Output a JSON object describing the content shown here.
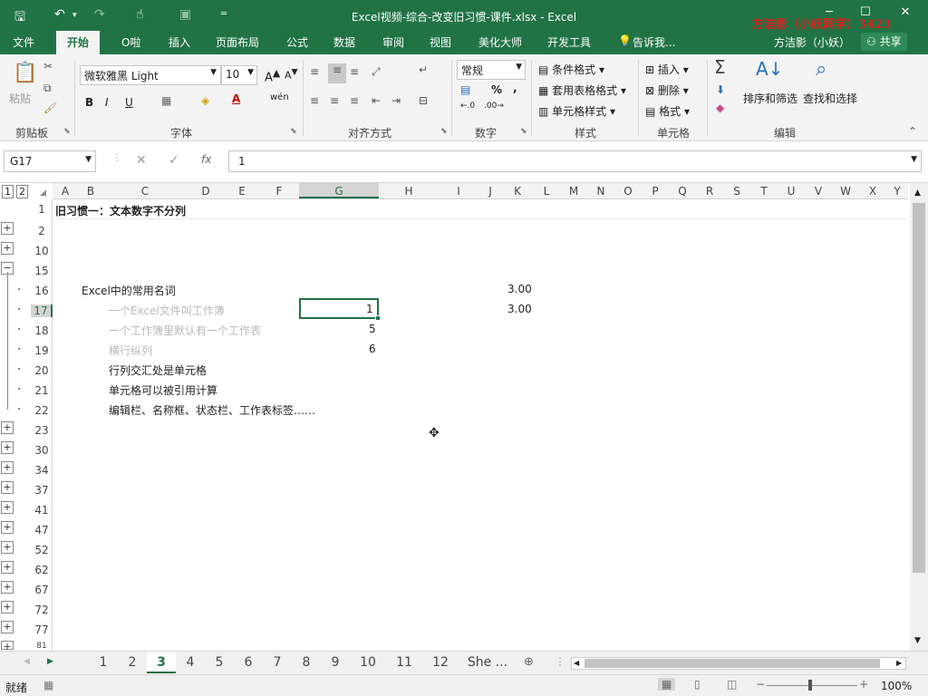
{
  "window": {
    "title": "Excel视频-综合-改变旧习惯-课件.xlsx - Excel",
    "watermark": "方洁影（小妖同学）3423",
    "user": "方洁影（小妖）",
    "share": "共享"
  },
  "tabs": [
    "文件",
    "开始",
    "O啦",
    "插入",
    "页面布局",
    "公式",
    "数据",
    "审阅",
    "视图",
    "美化大师",
    "开发工具",
    "告诉我..."
  ],
  "ribbon": {
    "clipboard": {
      "paste": "粘贴",
      "label": "剪贴板"
    },
    "font": {
      "name": "微软雅黑 Light",
      "size": "10",
      "bold": "B",
      "italic": "I",
      "underline": "U",
      "label": "字体"
    },
    "alignment": {
      "label": "对齐方式"
    },
    "number": {
      "format": "常规",
      "label": "数字"
    },
    "styles": {
      "conditional": "条件格式",
      "table": "套用表格格式",
      "cell": "单元格样式",
      "label": "样式"
    },
    "cells": {
      "insert": "插入",
      "delete": "删除",
      "format": "格式",
      "label": "单元格"
    },
    "editing": {
      "sort": "排序和筛选",
      "find": "查找和选择",
      "label": "编辑"
    }
  },
  "formula_bar": {
    "name_box": "G17",
    "fx": "fx",
    "value": "1"
  },
  "columns": [
    "A",
    "B",
    "C",
    "D",
    "E",
    "F",
    "G",
    "H",
    "I",
    "J",
    "K",
    "L",
    "M",
    "N",
    "O",
    "P",
    "Q",
    "R",
    "S",
    "T",
    "U",
    "V",
    "W",
    "X",
    "Y"
  ],
  "outline_levels": [
    "1",
    "2"
  ],
  "rows": [
    "1",
    "2",
    "10",
    "15",
    "16",
    "17",
    "18",
    "19",
    "20",
    "21",
    "22",
    "23",
    "30",
    "34",
    "37",
    "41",
    "47",
    "52",
    "62",
    "67",
    "72",
    "77",
    "81"
  ],
  "cells": {
    "r1": "旧习惯一：文本数字不分列",
    "r16c": "Excel中的常用名词",
    "r16k": "3.00",
    "r17c": "一个Excel文件叫工作簿",
    "r17g": "1",
    "r17k": "3.00",
    "r18c": "一个工作簿里默认有一个工作表",
    "r18g": "5",
    "r19c": "横行纵列",
    "r19g": "6",
    "r20c": "行列交汇处是单元格",
    "r21c": "单元格可以被引用计算",
    "r22c": "编辑栏、名称框、状态栏、工作表标签……"
  },
  "sheet_tabs": [
    "1",
    "2",
    "3",
    "4",
    "5",
    "6",
    "7",
    "8",
    "9",
    "10",
    "11",
    "12",
    "She ..."
  ],
  "active_sheet": "3",
  "status": {
    "ready": "就绪",
    "zoom": "100%"
  }
}
